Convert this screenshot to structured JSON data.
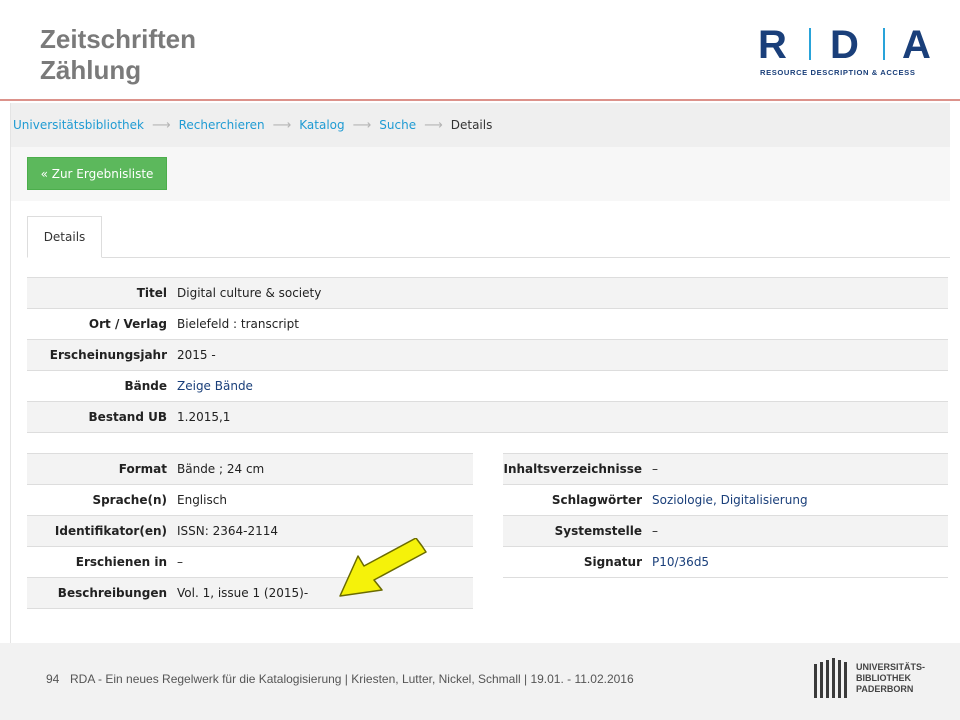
{
  "slide": {
    "title_line1": "Zeitschriften",
    "title_line2": "Zählung",
    "logo": {
      "letters": [
        "R",
        "D",
        "A"
      ],
      "subtitle": "RESOURCE DESCRIPTION & ACCESS",
      "color": "#1a3f7a",
      "divider_color": "#29a3d9"
    }
  },
  "breadcrumb": [
    {
      "label": "Universitätsbibliothek"
    },
    {
      "label": "Recherchieren"
    },
    {
      "label": "Katalog"
    },
    {
      "label": "Suche"
    },
    {
      "label": "Details"
    }
  ],
  "back_button": "« Zur Ergebnisliste",
  "tab": "Details",
  "main_rows": [
    {
      "label": "Titel",
      "value": "Digital culture & society",
      "link": false
    },
    {
      "label": "Ort / Verlag",
      "value": "Bielefeld : transcript",
      "link": false
    },
    {
      "label": "Erscheinungsjahr",
      "value": "2015 -",
      "link": false
    },
    {
      "label": "Bände",
      "value": "Zeige Bände",
      "link": true
    },
    {
      "label": "Bestand UB",
      "value": "1.2015,1",
      "link": false
    }
  ],
  "left_rows": [
    {
      "label": "Format",
      "value": "Bände ; 24 cm",
      "link": false
    },
    {
      "label": "Sprache(n)",
      "value": "Englisch",
      "link": false
    },
    {
      "label": "Identifikator(en)",
      "value": "ISSN: 2364-2114",
      "link": false
    },
    {
      "label": "Erschienen in",
      "value": "–",
      "link": false
    },
    {
      "label": "Beschreibungen",
      "value": "Vol. 1, issue 1 (2015)-",
      "link": false
    }
  ],
  "right_rows": [
    {
      "label": "Inhaltsverzeichnisse",
      "value": "–",
      "link": false
    },
    {
      "label": "Schlagwörter",
      "value": "Soziologie, Digitalisierung",
      "link": true
    },
    {
      "label": "Systemstelle",
      "value": "–",
      "link": false
    },
    {
      "label": "Signatur",
      "value": "P10/36d5",
      "link": true
    }
  ],
  "footer": {
    "page": "94",
    "text": "RDA - Ein neues Regelwerk  für die Katalogisierung | Kriesten, Lutter, Nickel, Schmall | 19.01. - 11.02.2016",
    "logo_lines": [
      "UNIVERSITÄTS-",
      "BIBLIOTHEK",
      "PADERBORN"
    ]
  },
  "colors": {
    "link": "#1f9bd3",
    "button_green": "#5cb85c",
    "arrow_yellow": "#f5f20a",
    "header_rule": "#c0392b"
  }
}
